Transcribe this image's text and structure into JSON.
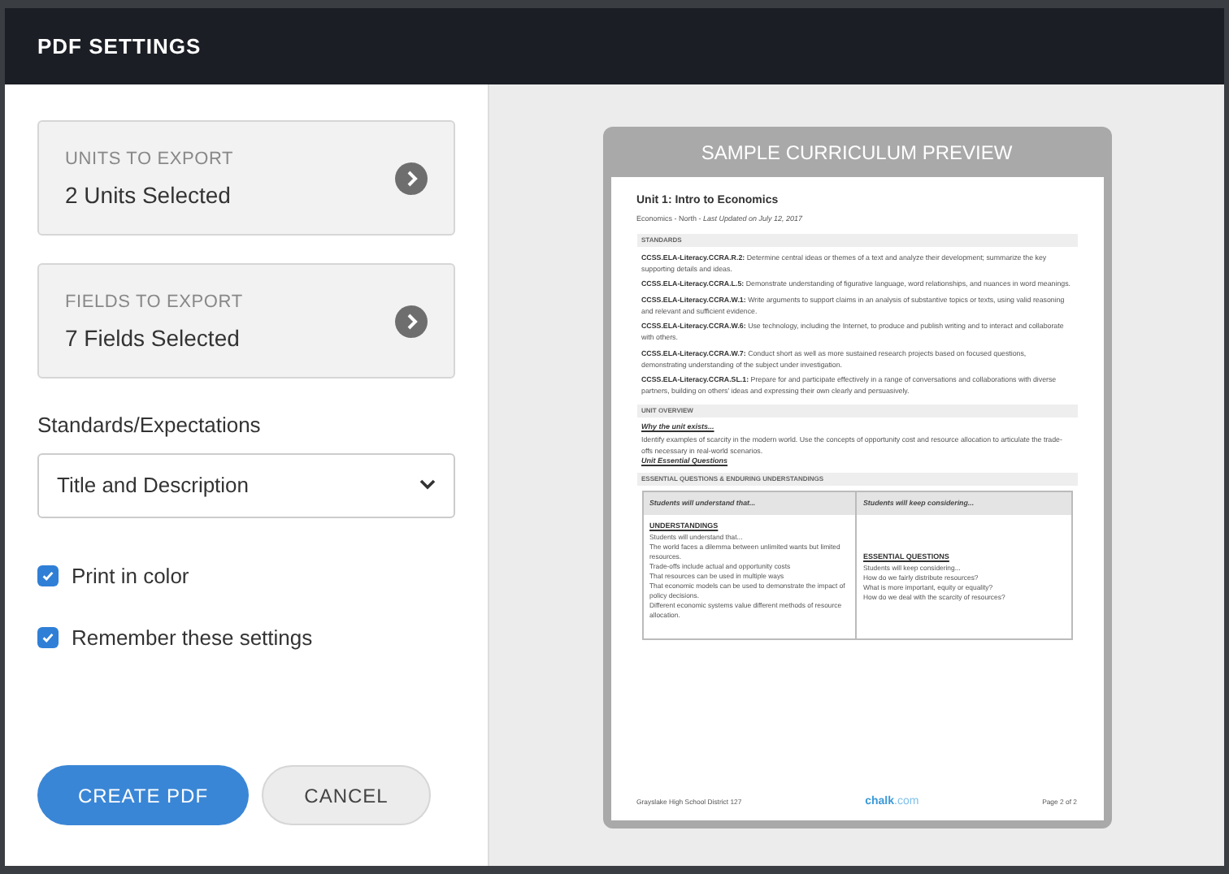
{
  "dialog": {
    "title": "PDF SETTINGS"
  },
  "export_cards": [
    {
      "label": "UNITS TO EXPORT",
      "value": "2 Units Selected"
    },
    {
      "label": "FIELDS TO EXPORT",
      "value": "7 Fields Selected"
    }
  ],
  "standards_select": {
    "label": "Standards/Expectations",
    "value": "Title and Description"
  },
  "options": [
    {
      "label": "Print in color",
      "checked": true
    },
    {
      "label": "Remember these settings",
      "checked": true
    }
  ],
  "buttons": {
    "primary": "CREATE PDF",
    "secondary": "CANCEL"
  },
  "preview": {
    "title": "SAMPLE CURRICULUM PREVIEW",
    "doc_title": "Unit 1: Intro to Economics",
    "doc_subtitle": "Economics - North - *Last Updated on July 12, 2017*",
    "standards_heading": "STANDARDS",
    "standards": [
      {
        "code": "CCSS.ELA-Literacy.CCRA.R.2:",
        "text": "Determine central ideas or themes of a text and analyze their development; summarize the key supporting details and ideas."
      },
      {
        "code": "CCSS.ELA-Literacy.CCRA.L.5:",
        "text": "Demonstrate understanding of figurative language, word relationships, and nuances in word meanings."
      },
      {
        "code": "CCSS.ELA-Literacy.CCRA.W.1:",
        "text": "Write arguments to support claims in an analysis of substantive topics or texts, using valid reasoning and relevant and sufficient evidence."
      },
      {
        "code": "CCSS.ELA-Literacy.CCRA.W.6:",
        "text": "Use technology, including the Internet, to produce and publish writing and to interact and collaborate with others."
      },
      {
        "code": "CCSS.ELA-Literacy.CCRA.W.7:",
        "text": "Conduct short as well as more sustained research projects based on focused questions, demonstrating understanding of the subject under investigation."
      },
      {
        "code": "CCSS.ELA-Literacy.CCRA.SL.1:",
        "text": "Prepare for and participate effectively in a range of conversations and collaborations with diverse partners, building on others' ideas and expressing their own clearly and persuasively."
      }
    ],
    "overview_heading": "UNIT OVERVIEW",
    "overview_link": "Why the unit exists...",
    "overview_text": "Identify examples of scarcity in the modern world. Use the concepts of opportunity cost and resource allocation to articulate the trade-offs necessary in real-world scenarios.",
    "questions_link": "Unit Essential Questions",
    "eq_heading": "ESSENTIAL QUESTIONS & ENDURING UNDERSTANDINGS",
    "table": {
      "columns": [
        "Students will understand that...",
        "Students will keep considering..."
      ],
      "cells": [
        {
          "heading": "UNDERSTANDINGS",
          "lines": [
            "Students will understand that...",
            "The world faces a dilemma between unlimited wants but limited resources.",
            "Trade-offs include actual and opportunity costs",
            "That resources can be used in multiple ways",
            "That economic models can be used to demonstrate the impact of policy decisions.",
            "Different economic systems value different methods of resource allocation."
          ]
        },
        {
          "heading": "ESSENTIAL QUESTIONS",
          "lines": [
            "Students will keep considering...",
            "How do we fairly distribute resources?",
            "What is more important, equity or equality?",
            "How do we deal with the scarcity of resources?"
          ]
        }
      ]
    },
    "footer": {
      "district": "Grayslake High School District 127",
      "brand": "chalk",
      "brand_suffix": ".com",
      "page": "Page 2 of 2"
    }
  }
}
